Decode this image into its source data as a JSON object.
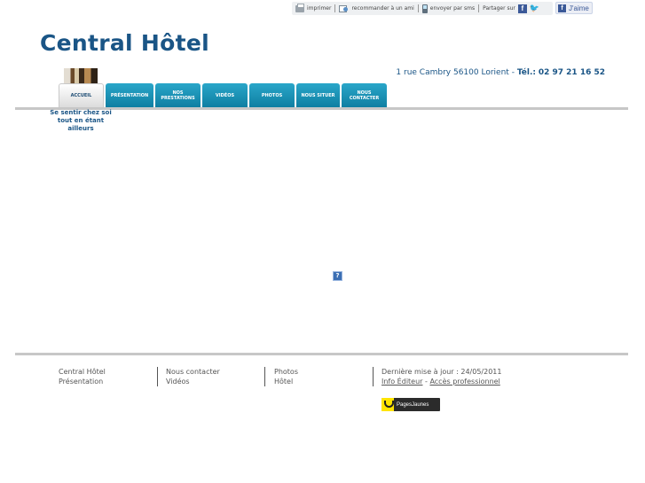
{
  "utility_bar": {
    "print_label": "imprimer",
    "recommend_label": "recommander à un ami",
    "sms_label": "envoyer par sms",
    "share_label": "Partager sur"
  },
  "facebook_like": {
    "label": "J'aime"
  },
  "header": {
    "site_title": "Central Hôtel",
    "address": "1 rue Cambry 56100 Lorient",
    "separator": "-",
    "tel_label": "Tél.:",
    "tel_number": "02 97 21 16 52"
  },
  "nav": {
    "tabs": [
      {
        "label": "ACCUEIL",
        "active": true
      },
      {
        "label": "PRÉSENTATION",
        "active": false
      },
      {
        "label": "NOS PRESTATIONS",
        "active": false
      },
      {
        "label": "VIDÉOS",
        "active": false
      },
      {
        "label": "PHOTOS",
        "active": false
      },
      {
        "label": "NOUS SITUER",
        "active": false
      },
      {
        "label": "NOUS CONTACTER",
        "active": false
      }
    ]
  },
  "tagline": "Se sentir chez soi tout en étant ailleurs",
  "plugin_placeholder": "?",
  "footer": {
    "col1": [
      "Central Hôtel",
      "Présentation"
    ],
    "col2": [
      "Nous contacter",
      "Vidéos"
    ],
    "col3": [
      "Photos",
      "Hôtel"
    ],
    "last_update": "Dernière mise à jour : 24/05/2011",
    "info_editeur": "Info Éditeur",
    "link_separator": "-",
    "acces_pro": "Accès professionnel",
    "pagesjaunes_label": "PagesJaunes"
  },
  "colors": {
    "brand": "#1a5586",
    "nav_tab": "#1a93b8",
    "rule": "#c7c7c7"
  }
}
